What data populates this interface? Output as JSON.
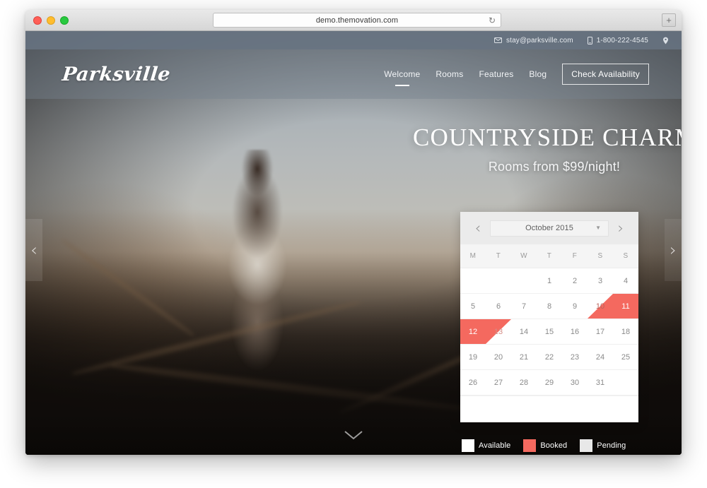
{
  "browser": {
    "url": "demo.themovation.com",
    "reload_icon": "reload-icon",
    "new_tab_label": "+"
  },
  "topbar": {
    "email": "stay@parksville.com",
    "phone": "1-800-222-4545",
    "email_icon": "envelope-icon",
    "phone_icon": "mobile-phone-icon",
    "location_icon": "map-pin-icon"
  },
  "header": {
    "logo": "Parksville",
    "nav": [
      {
        "label": "Welcome",
        "active": true
      },
      {
        "label": "Rooms",
        "active": false
      },
      {
        "label": "Features",
        "active": false
      },
      {
        "label": "Blog",
        "active": false
      }
    ],
    "cta": "Check Availability"
  },
  "hero": {
    "title": "COUNTRYSIDE CHARM",
    "subtitle": "Rooms from $99/night!",
    "prev_arrow": "‹",
    "next_arrow": "›",
    "scroll_down_icon": "chevron-down-icon",
    "scroll_down_glyph": "⌄"
  },
  "calendar": {
    "prev_label": "‹",
    "next_label": "›",
    "month": "October 2015",
    "caret": "▼",
    "day_headers": [
      "M",
      "T",
      "W",
      "T",
      "F",
      "S",
      "S"
    ],
    "weeks": [
      [
        {
          "day": "",
          "state": "empty"
        },
        {
          "day": "",
          "state": "empty"
        },
        {
          "day": "",
          "state": "empty"
        },
        {
          "day": "1",
          "state": "available"
        },
        {
          "day": "2",
          "state": "available"
        },
        {
          "day": "3",
          "state": "available"
        },
        {
          "day": "4",
          "state": "available"
        }
      ],
      [
        {
          "day": "5",
          "state": "available"
        },
        {
          "day": "6",
          "state": "available"
        },
        {
          "day": "7",
          "state": "available"
        },
        {
          "day": "8",
          "state": "available"
        },
        {
          "day": "9",
          "state": "available"
        },
        {
          "day": "10",
          "state": "checkin"
        },
        {
          "day": "11",
          "state": "booked"
        }
      ],
      [
        {
          "day": "12",
          "state": "booked"
        },
        {
          "day": "13",
          "state": "checkout"
        },
        {
          "day": "14",
          "state": "available"
        },
        {
          "day": "15",
          "state": "available"
        },
        {
          "day": "16",
          "state": "available"
        },
        {
          "day": "17",
          "state": "available"
        },
        {
          "day": "18",
          "state": "available"
        }
      ],
      [
        {
          "day": "19",
          "state": "available"
        },
        {
          "day": "20",
          "state": "available"
        },
        {
          "day": "21",
          "state": "available"
        },
        {
          "day": "22",
          "state": "available"
        },
        {
          "day": "23",
          "state": "available"
        },
        {
          "day": "24",
          "state": "available"
        },
        {
          "day": "25",
          "state": "available"
        }
      ],
      [
        {
          "day": "26",
          "state": "available"
        },
        {
          "day": "27",
          "state": "available"
        },
        {
          "day": "28",
          "state": "available"
        },
        {
          "day": "29",
          "state": "available"
        },
        {
          "day": "30",
          "state": "available"
        },
        {
          "day": "31",
          "state": "available"
        },
        {
          "day": "",
          "state": "empty"
        }
      ]
    ]
  },
  "legend": [
    {
      "label": "Available",
      "color": "#ffffff"
    },
    {
      "label": "Booked",
      "color": "#f4695f"
    },
    {
      "label": "Pending",
      "color": "#e8e8e8"
    }
  ],
  "colors": {
    "accent": "#f4695f",
    "topbar": "#687482",
    "calendar_header": "#ebebeb"
  }
}
